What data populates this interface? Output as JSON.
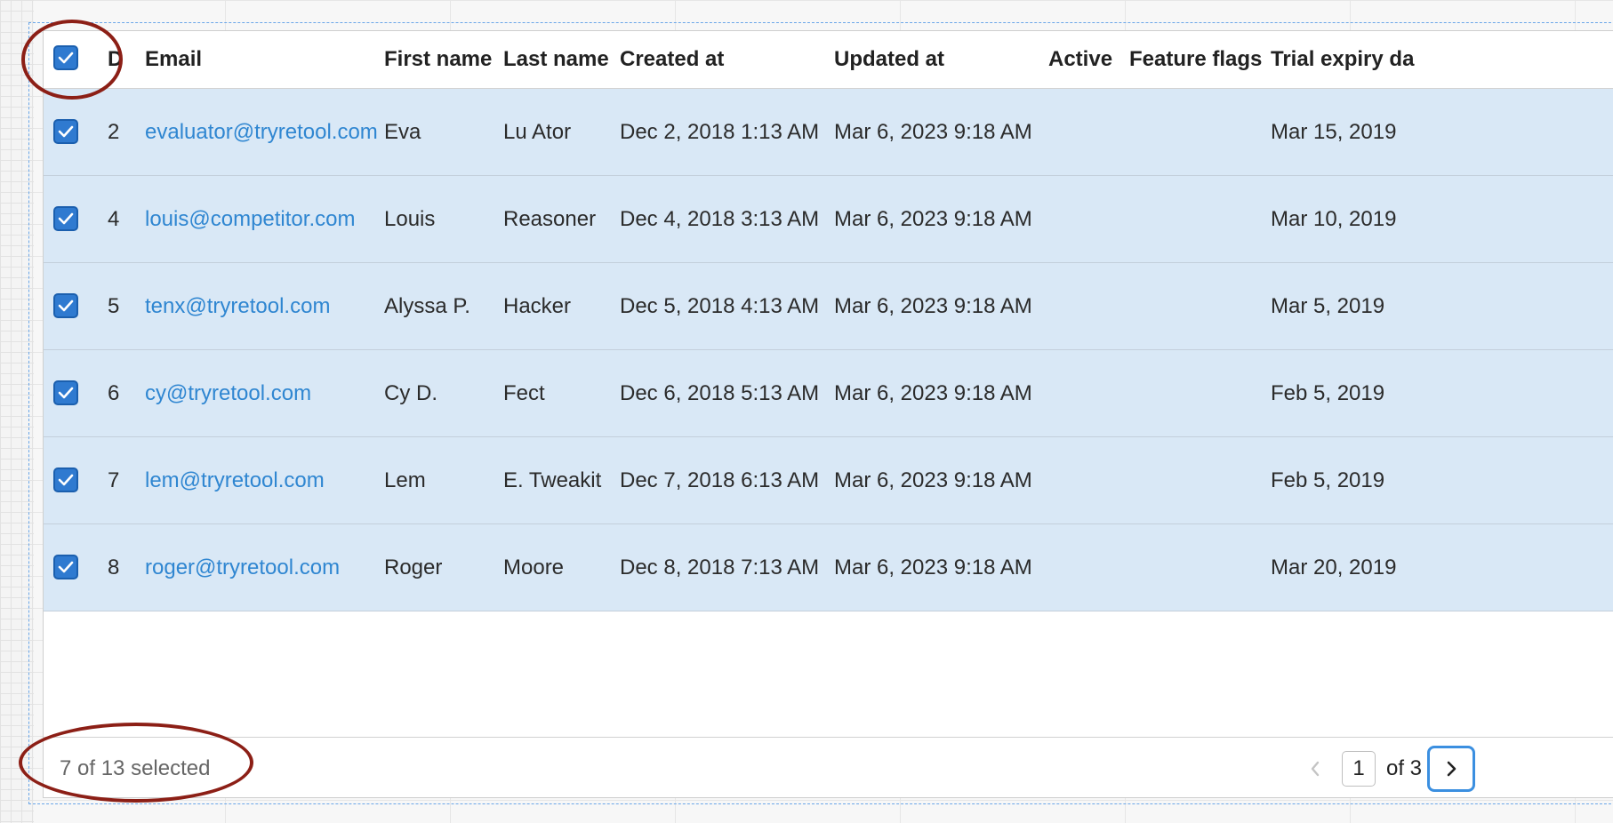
{
  "table": {
    "columns": {
      "id": "D",
      "email": "Email",
      "first_name": "First name",
      "last_name": "Last name",
      "created_at": "Created at",
      "updated_at": "Updated at",
      "active": "Active",
      "feature_flags": "Feature flags",
      "trial_expiry": "Trial expiry da"
    },
    "rows": [
      {
        "id": "2",
        "email": "evaluator@tryretool.com",
        "first_name": "Eva",
        "last_name": "Lu Ator",
        "created_at": "Dec 2, 2018 1:13 AM",
        "updated_at": "Mar 6, 2023 9:18 AM",
        "active": "",
        "feature_flags": "",
        "trial_expiry": "Mar 15, 2019",
        "selected": true
      },
      {
        "id": "4",
        "email": "louis@competitor.com",
        "first_name": "Louis",
        "last_name": "Reasoner",
        "created_at": "Dec 4, 2018 3:13 AM",
        "updated_at": "Mar 6, 2023 9:18 AM",
        "active": "",
        "feature_flags": "",
        "trial_expiry": "Mar 10, 2019",
        "selected": true
      },
      {
        "id": "5",
        "email": "tenx@tryretool.com",
        "first_name": "Alyssa P.",
        "last_name": "Hacker",
        "created_at": "Dec 5, 2018 4:13 AM",
        "updated_at": "Mar 6, 2023 9:18 AM",
        "active": "",
        "feature_flags": "",
        "trial_expiry": "Mar 5, 2019",
        "selected": true
      },
      {
        "id": "6",
        "email": "cy@tryretool.com",
        "first_name": "Cy D.",
        "last_name": "Fect",
        "created_at": "Dec 6, 2018 5:13 AM",
        "updated_at": "Mar 6, 2023 9:18 AM",
        "active": "",
        "feature_flags": "",
        "trial_expiry": "Feb 5, 2019",
        "selected": true
      },
      {
        "id": "7",
        "email": "lem@tryretool.com",
        "first_name": "Lem",
        "last_name": "E. Tweakit",
        "created_at": "Dec 7, 2018 6:13 AM",
        "updated_at": "Mar 6, 2023 9:18 AM",
        "active": "",
        "feature_flags": "",
        "trial_expiry": "Feb 5, 2019",
        "selected": true
      },
      {
        "id": "8",
        "email": "roger@tryretool.com",
        "first_name": "Roger",
        "last_name": "Moore",
        "created_at": "Dec 8, 2018 7:13 AM",
        "updated_at": "Mar 6, 2023 9:18 AM",
        "active": "",
        "feature_flags": "",
        "trial_expiry": "Mar 20, 2019",
        "selected": true
      }
    ],
    "select_all_checked": true
  },
  "footer": {
    "selection_text": "7 of 13 selected",
    "current_page": "1",
    "total_pages_text": "of 3"
  },
  "icons": {
    "checkbox": "check-icon",
    "prev": "chevron-left-icon",
    "next": "chevron-right-icon"
  },
  "colors": {
    "selected_row": "#d9e8f6",
    "checkbox": "#2f7ad0",
    "link": "#2f86d1",
    "annotation": "#8c1f16",
    "focus_ring": "#3b8fe0"
  }
}
